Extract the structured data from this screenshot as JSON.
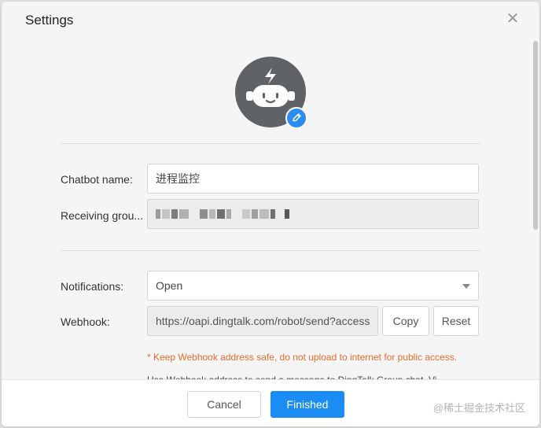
{
  "dialog": {
    "title": "Settings",
    "close_icon": "close-icon"
  },
  "avatar": {
    "icon": "robot-icon",
    "edit_icon": "pencil-icon"
  },
  "form": {
    "chatbot_name_label": "Chatbot name:",
    "chatbot_name_value": "进程监控",
    "receiving_group_label": "Receiving grou...",
    "notifications_label": "Notifications:",
    "notifications_value": "Open",
    "webhook_label": "Webhook:",
    "webhook_value": "https://oapi.dingtalk.com/robot/send?access",
    "copy_label": "Copy",
    "reset_label": "Reset",
    "warning": "* Keep Webhook address safe, do not upload to internet for public access.",
    "hint": "Use Webhook address to send a message to DingTalk Group chat. Vi"
  },
  "footer": {
    "cancel_label": "Cancel",
    "finished_label": "Finished"
  },
  "watermark": "@稀土掘金技术社区",
  "colors": {
    "primary": "#1a8cf3",
    "warning": "#e86c2c",
    "avatar_bg": "#5f6368"
  }
}
